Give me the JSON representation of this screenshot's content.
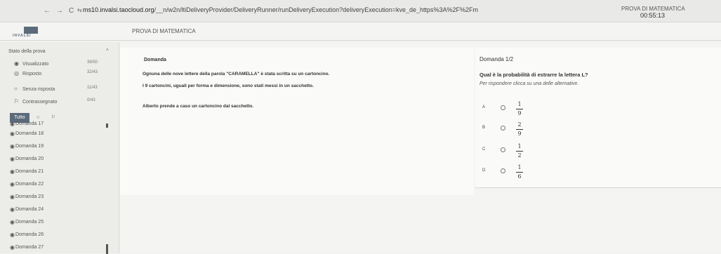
{
  "browser": {
    "url_host": "ms10.invalsi.taocloud.org",
    "url_path": "/__n/w2n/ltiDeliveryProvider/DeliveryRunner/runDeliveryExecution?deliveryExecution=kve_de_https%3A%2F%2Fm",
    "back_icon": "←",
    "forward_icon": "→",
    "reload_icon": "C",
    "tune_icon": "⇆"
  },
  "header": {
    "exam_title_top": "PROVA DI MATEMATICA",
    "timer": "00:55:13",
    "logo_text": "INVALSI",
    "exam_name": "PROVA DI MATEMATICA"
  },
  "sidebar": {
    "heading": "Stato della prova",
    "collapse_icon": "^",
    "stats": [
      {
        "icon": "◉",
        "label": "Visualizzato",
        "count": "38/50"
      },
      {
        "icon": "◎",
        "label": "Risposto",
        "count": "32/43"
      },
      {
        "icon": "○",
        "label": "Senza risposta",
        "count": "11/43"
      },
      {
        "icon": "⚐",
        "label": "Contrassegnato",
        "count": "0/43"
      }
    ],
    "filters": [
      {
        "label": "Tutto",
        "active": true
      },
      {
        "label": "○",
        "active": false
      },
      {
        "label": "⚐",
        "active": false
      }
    ],
    "items": [
      {
        "icon": "◉",
        "label": "Domanda 17"
      },
      {
        "icon": "◉",
        "label": "Domanda 18"
      },
      {
        "icon": "◉",
        "label": "Domanda 19"
      },
      {
        "icon": "◉",
        "label": "Domanda 20"
      },
      {
        "icon": "◉",
        "label": "Domanda 21"
      },
      {
        "icon": "◉",
        "label": "Domanda 22"
      },
      {
        "icon": "◉",
        "label": "Domanda 23"
      },
      {
        "icon": "◉",
        "label": "Domanda 24"
      },
      {
        "icon": "◉",
        "label": "Domanda 25"
      },
      {
        "icon": "◉",
        "label": "Domanda 26"
      },
      {
        "icon": "◉",
        "label": "Domanda 27"
      }
    ]
  },
  "stimulus": {
    "label": "Domanda",
    "lines": [
      "Ognuna delle nove lettere della parola \"CARAMELLA\" è stata scritta su un cartoncino.",
      "I 9 cartoncini, uguali per forma e dimensione, sono stati messi in un sacchetto.",
      "Alberto prende a caso un cartoncino dal sacchetto."
    ]
  },
  "question": {
    "number": "Domanda 1/2",
    "text": "Qual è la probabilità di estrarre la lettera L?",
    "instruction": "Per rispondere clicca su una delle alternative.",
    "choices": [
      {
        "letter": "A",
        "numerator": "1",
        "denominator": "9"
      },
      {
        "letter": "B",
        "numerator": "2",
        "denominator": "9"
      },
      {
        "letter": "C",
        "numerator": "1",
        "denominator": "2"
      },
      {
        "letter": "D",
        "numerator": "1",
        "denominator": "6"
      }
    ]
  }
}
